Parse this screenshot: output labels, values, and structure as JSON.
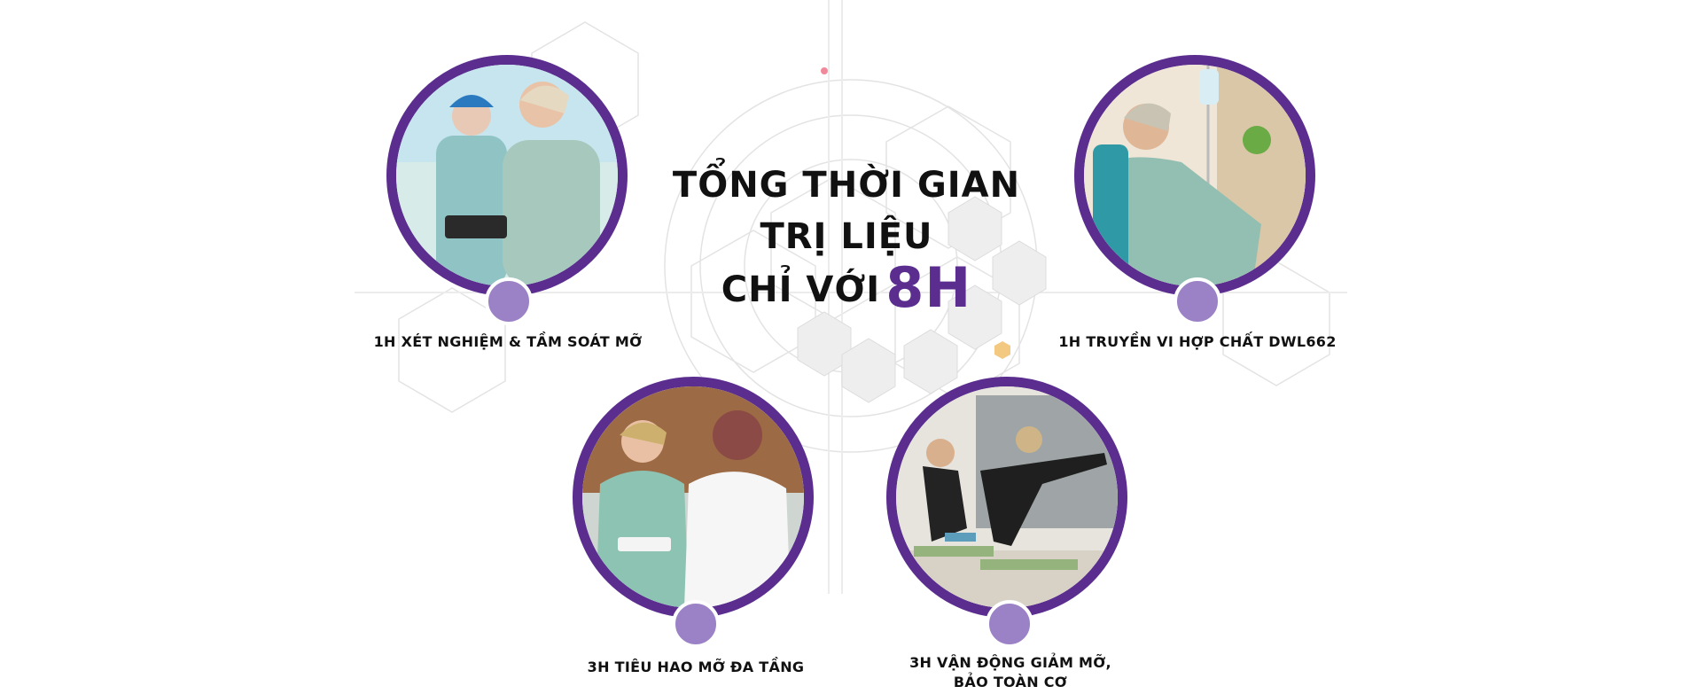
{
  "headline": {
    "line1": "TỔNG THỜI GIAN",
    "line2": "TRỊ LIỆU",
    "line3": "CHỈ VỚI",
    "highlight": "8H"
  },
  "steps": [
    {
      "label": "1H XÉT NGHIỆM & TẦM SOÁT MỠ"
    },
    {
      "label": "1H TRUYỀN VI HỢP CHẤT DWL662"
    },
    {
      "label": "3H TIÊU HAO MỠ ĐA TẦNG"
    },
    {
      "label_line1": "3H VẬN ĐỘNG GIẢM MỠ,",
      "label_line2": "BẢO TOÀN CƠ"
    }
  ],
  "colors": {
    "accent": "#5b2d8f",
    "marker": "#9b82c6",
    "background": "#ffffff"
  }
}
